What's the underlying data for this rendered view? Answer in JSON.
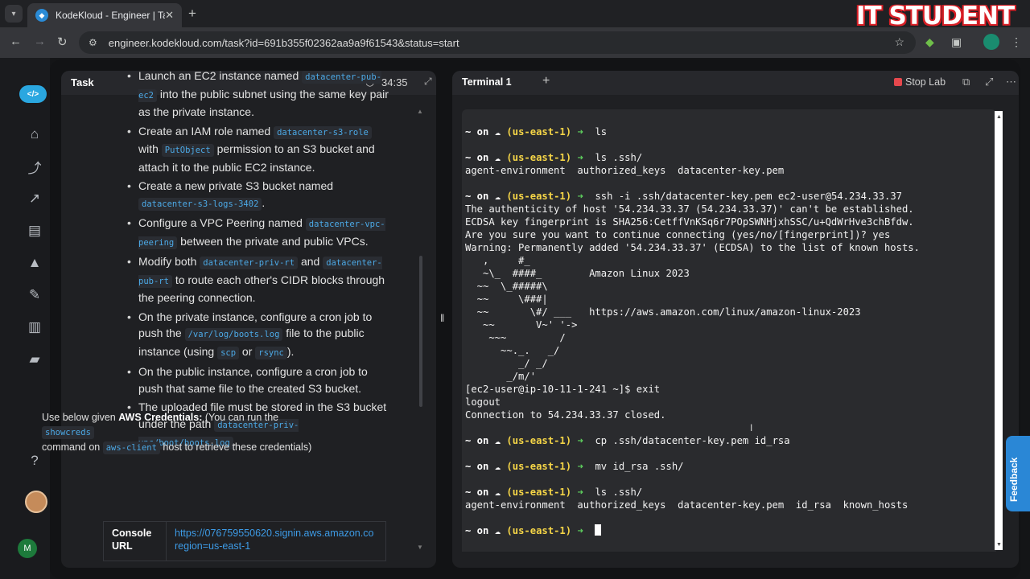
{
  "browser": {
    "tab_title": "KodeKloud - Engineer | Task",
    "url": "engineer.kodekloud.com/task?id=691b355f02362aa9a9f61543&status=start",
    "watermark": "IT STUDENT"
  },
  "task_panel": {
    "title": "Task",
    "timer": "34:35",
    "items": [
      [
        "Launch an EC2 instance named ",
        {
          "code": "datacenter-pub-ec2"
        },
        " into the public subnet using the same key pair as the private instance."
      ],
      [
        "Create an IAM role named ",
        {
          "code": "datacenter-s3-role"
        },
        " with ",
        {
          "code": "PutObject"
        },
        " permission to an S3 bucket and attach it to the public EC2 instance."
      ],
      [
        "Create a new private S3 bucket named ",
        {
          "code": "datacenter-s3-logs-3402"
        },
        "."
      ],
      [
        "Configure a VPC Peering named ",
        {
          "code": "datacenter-vpc-peering"
        },
        " between the private and public VPCs."
      ],
      [
        "Modify both ",
        {
          "code": "datacenter-priv-rt"
        },
        " and ",
        {
          "code": "datacenter-pub-rt"
        },
        " to route each other's CIDR blocks through the peering connection."
      ],
      [
        "On the private instance, configure a cron job to push the ",
        {
          "code": "/var/log/boots.log"
        },
        " file to the public instance (using ",
        {
          "code": "scp"
        },
        " or ",
        {
          "code": "rsync"
        },
        ")."
      ],
      [
        "On the public instance, configure a cron job to push that same file to the created S3 bucket."
      ],
      [
        "The uploaded file must be stored in the S3 bucket under the path ",
        {
          "code": "datacenter-priv-vpc/boot/boots.log"
        },
        "."
      ]
    ],
    "creds_intro_pre": "Use below given ",
    "creds_intro_bold": "AWS Credentials:",
    "creds_intro_post": " (You can run the ",
    "creds_cmd": "showcreds",
    "creds_mid": " command on ",
    "creds_host": "aws-client",
    "creds_end": " host to retrieve these credentials)",
    "console_label": "Console URL",
    "console_url_line1": "https://076759550620.signin.aws.amazon.co",
    "console_url_line2": "region=us-east-1"
  },
  "terminal_panel": {
    "tab_label": "Terminal 1",
    "stop_label": "Stop Lab",
    "feedback_label": "Feedback",
    "prompt": {
      "tilde": "~",
      "on": " on ",
      "cloud": "☁",
      "region": "(us-east-1)",
      "arrow": "➜"
    },
    "lines": [
      {
        "type": "prompt",
        "cmd": "ls"
      },
      {
        "type": "blank"
      },
      {
        "type": "prompt",
        "cmd": "ls .ssh/"
      },
      {
        "type": "out",
        "text": "agent-environment  authorized_keys  datacenter-key.pem"
      },
      {
        "type": "blank"
      },
      {
        "type": "prompt",
        "cmd": "ssh -i .ssh/datacenter-key.pem ec2-user@54.234.33.37"
      },
      {
        "type": "out",
        "text": "The authenticity of host '54.234.33.37 (54.234.33.37)' can't be established."
      },
      {
        "type": "out",
        "text": "ECDSA key fingerprint is SHA256:CetffVnKSq6r7POpSWNHjxhSSC/u+QdWrHve3chBfdw."
      },
      {
        "type": "out",
        "text": "Are you sure you want to continue connecting (yes/no/[fingerprint])? yes"
      },
      {
        "type": "out",
        "text": "Warning: Permanently added '54.234.33.37' (ECDSA) to the list of known hosts."
      },
      {
        "type": "out",
        "text": "   ,     #_"
      },
      {
        "type": "out",
        "text": "   ~\\_  ####_        Amazon Linux 2023"
      },
      {
        "type": "out",
        "text": "  ~~  \\_#####\\"
      },
      {
        "type": "out",
        "text": "  ~~     \\###|"
      },
      {
        "type": "out",
        "text": "  ~~       \\#/ ___   https://aws.amazon.com/linux/amazon-linux-2023"
      },
      {
        "type": "out",
        "text": "   ~~       V~' '->"
      },
      {
        "type": "out",
        "text": "    ~~~         /"
      },
      {
        "type": "out",
        "text": "      ~~._.   _/"
      },
      {
        "type": "out",
        "text": "         _/ _/"
      },
      {
        "type": "out",
        "text": "       _/m/'"
      },
      {
        "type": "out",
        "text": "[ec2-user@ip-10-11-1-241 ~]$ exit"
      },
      {
        "type": "out",
        "text": "logout"
      },
      {
        "type": "out",
        "text": "Connection to 54.234.33.37 closed."
      },
      {
        "type": "blank"
      },
      {
        "type": "prompt",
        "cmd": "cp .ssh/datacenter-key.pem id_rsa"
      },
      {
        "type": "blank"
      },
      {
        "type": "prompt",
        "cmd": "mv id_rsa .ssh/"
      },
      {
        "type": "blank"
      },
      {
        "type": "prompt",
        "cmd": "ls .ssh/"
      },
      {
        "type": "out",
        "text": "agent-environment  authorized_keys  datacenter-key.pem  id_rsa  known_hosts"
      },
      {
        "type": "blank"
      },
      {
        "type": "prompt",
        "cmd": "",
        "cursor": true
      }
    ]
  },
  "rail": {
    "user_initial": "M"
  },
  "colors": {
    "accent": "#2a87d6",
    "prompt_region": "#f5d547",
    "prompt_arrow": "#5fd35f",
    "stop": "#e5484d"
  }
}
